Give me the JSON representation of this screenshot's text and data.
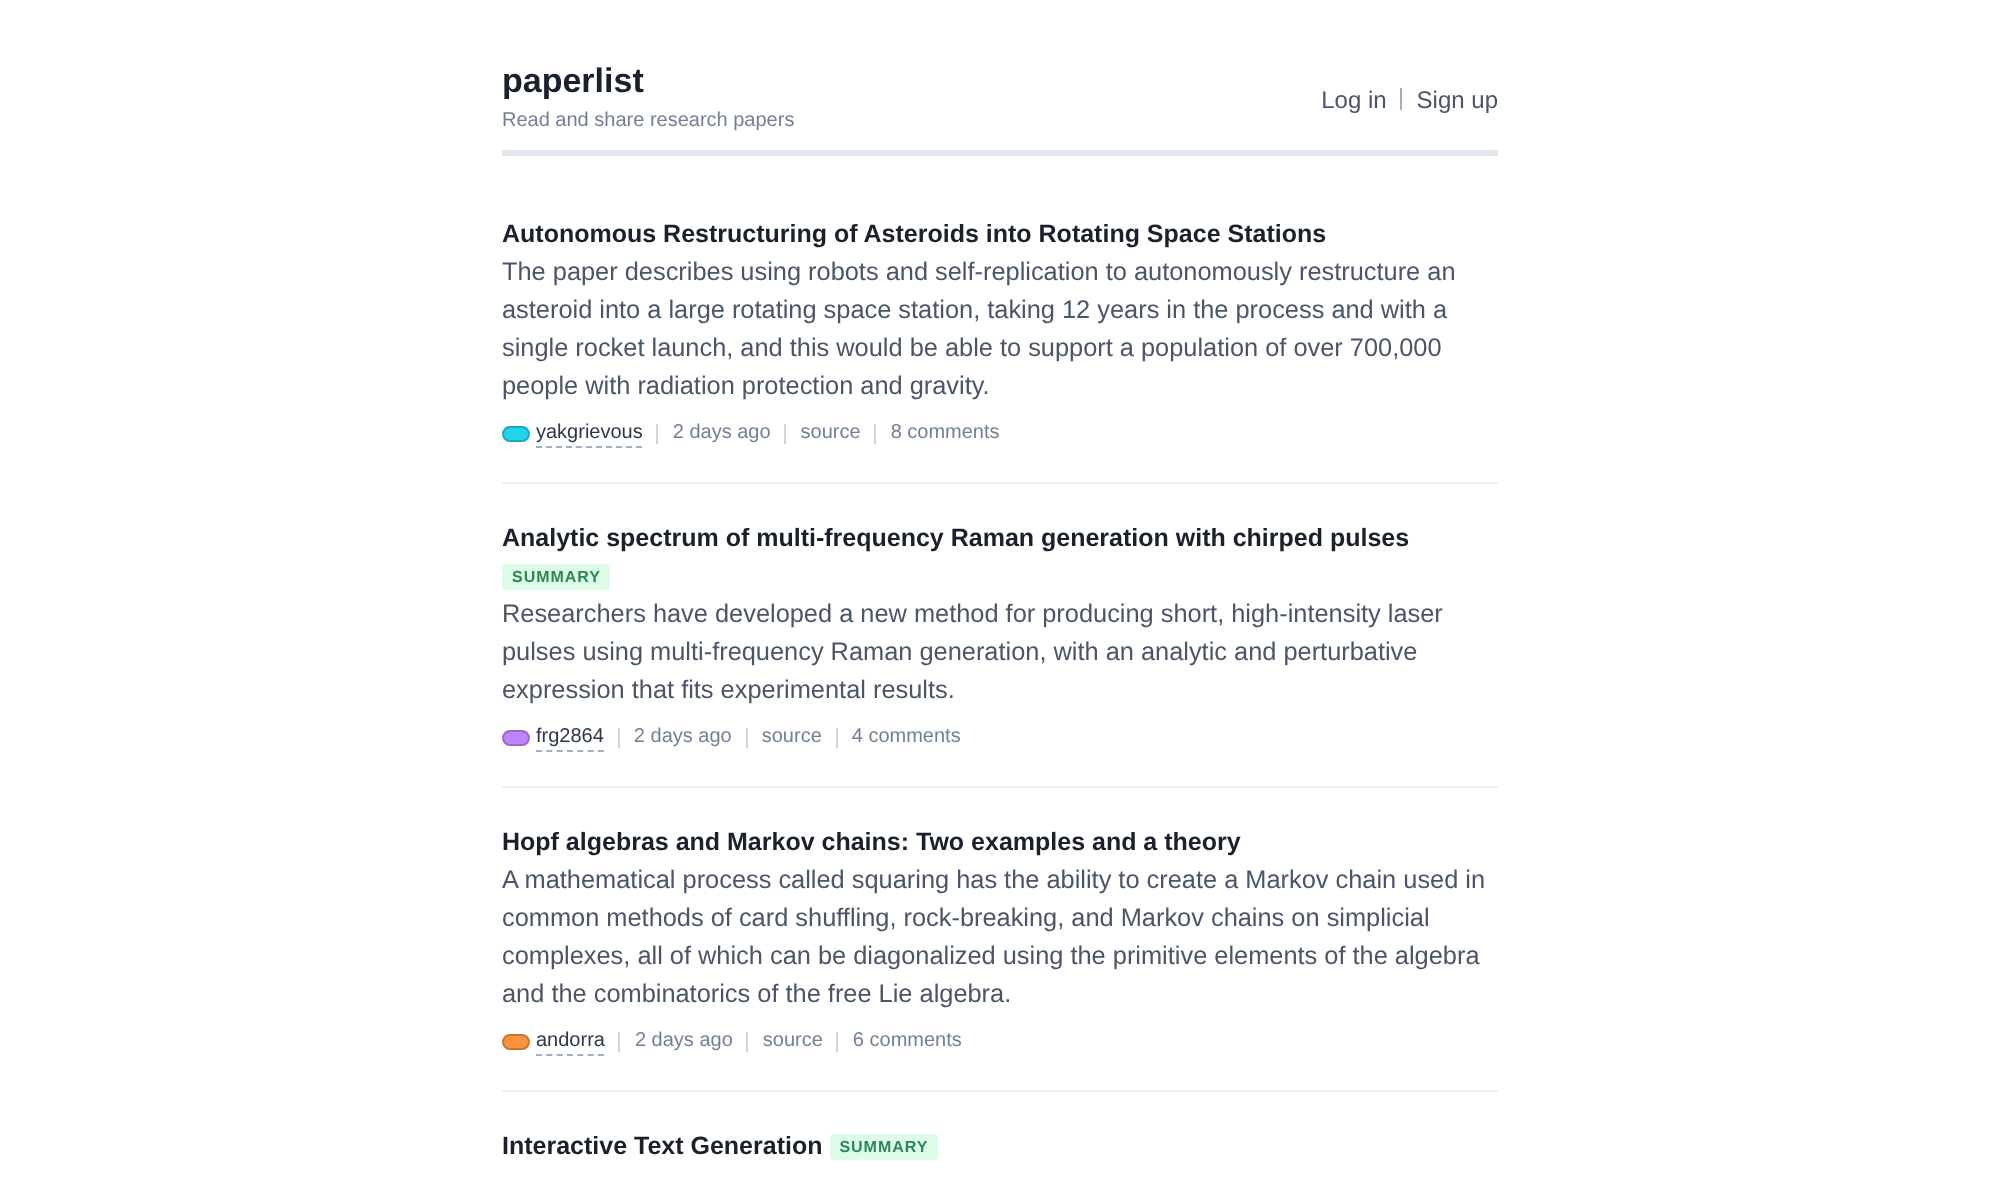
{
  "site": {
    "title": "paperlist",
    "tagline": "Read and share research papers"
  },
  "auth_links": [
    {
      "label": "Log in"
    },
    {
      "label": "Sign up"
    }
  ],
  "papers": [
    {
      "title": "Autonomous Restructuring of Asteroids into Rotating Space Stations",
      "summary": "The paper describes using robots and self-replication to autonomously restructure an asteroid into a large rotating space station, taking 12 years in the process and with a single rocket launch, and this would be able to support a population of over 700,000 people with radiation protection and gravity.",
      "author": {
        "name": "yakgrievous",
        "color": "#22d3ee"
      },
      "age": "2 days ago",
      "source": "source",
      "comments": "8 comments"
    },
    {
      "title": "Analytic spectrum of multi-frequency Raman generation with chirped pulses",
      "badge": "SUMMARY",
      "summary": "Researchers have developed a new method for producing short, high-intensity laser pulses using multi-frequency Raman generation, with an analytic and perturbative expression that fits experimental results.",
      "author": {
        "name": "frg2864",
        "color": "#c084fc"
      },
      "age": "2 days ago",
      "source": "source",
      "comments": "4 comments"
    },
    {
      "title": "Hopf algebras and Markov chains: Two examples and a theory",
      "summary": "A mathematical process called squaring has the ability to create a Markov chain used in common methods of card shuffling, rock-breaking, and Markov chains on simplicial complexes, all of which can be diagonalized using the primitive elements of the algebra and the combinatorics of the free Lie algebra.",
      "author": {
        "name": "andorra",
        "color": "#fb923c"
      },
      "age": "2 days ago",
      "source": "source",
      "comments": "6 comments"
    },
    {
      "title": "Interactive Text Generation",
      "badge": "SUMMARY"
    }
  ]
}
